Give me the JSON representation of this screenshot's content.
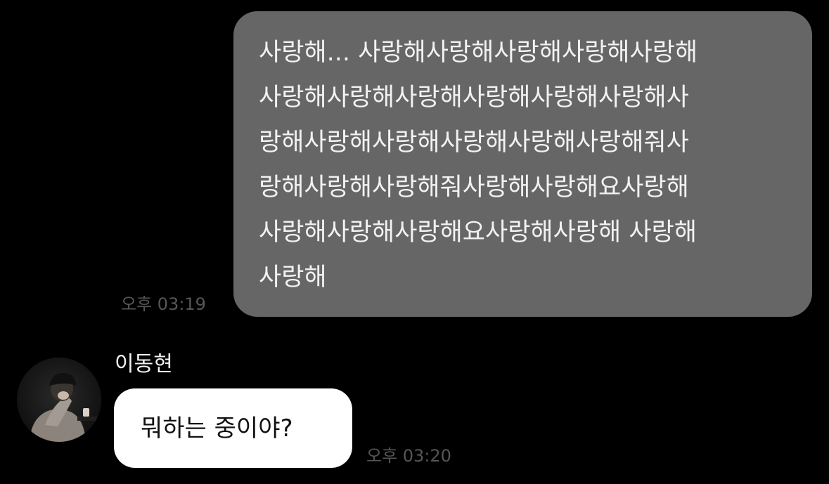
{
  "outgoing_message": {
    "lines": [
      "사랑해... 사랑해사랑해사랑해사랑해사랑해",
      "사랑해사랑해사랑해사랑해사랑해사랑해사",
      "랑해사랑해사랑해사랑해사랑해사랑해줘사",
      "랑해사랑해사랑해줘사랑해사랑해요사랑해",
      "사랑해사랑해사랑해요사랑해사랑해 사랑해",
      "사랑해"
    ],
    "time": "오후 03:19",
    "bubble_color": "#666666"
  },
  "incoming_message": {
    "sender": "이동현",
    "text": "뭐하는 중이야?",
    "time": "오후 03:20",
    "bubble_color": "#ffffff"
  },
  "colors": {
    "background": "#000000",
    "timestamp": "#565656"
  }
}
